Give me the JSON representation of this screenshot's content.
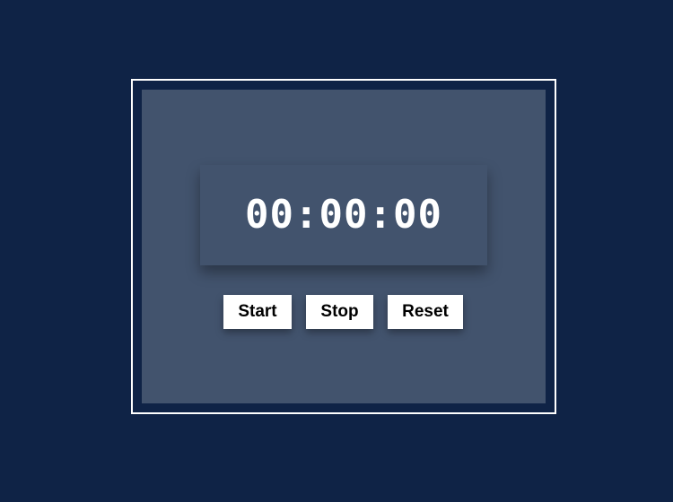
{
  "stopwatch": {
    "time": "00:00:00",
    "buttons": {
      "start_label": "Start",
      "stop_label": "Stop",
      "reset_label": "Reset"
    }
  },
  "colors": {
    "background": "#0f2346",
    "panel": "#42536d",
    "frame_border": "#ffffff",
    "text": "#ffffff",
    "button_bg": "#ffffff",
    "button_text": "#000000"
  }
}
